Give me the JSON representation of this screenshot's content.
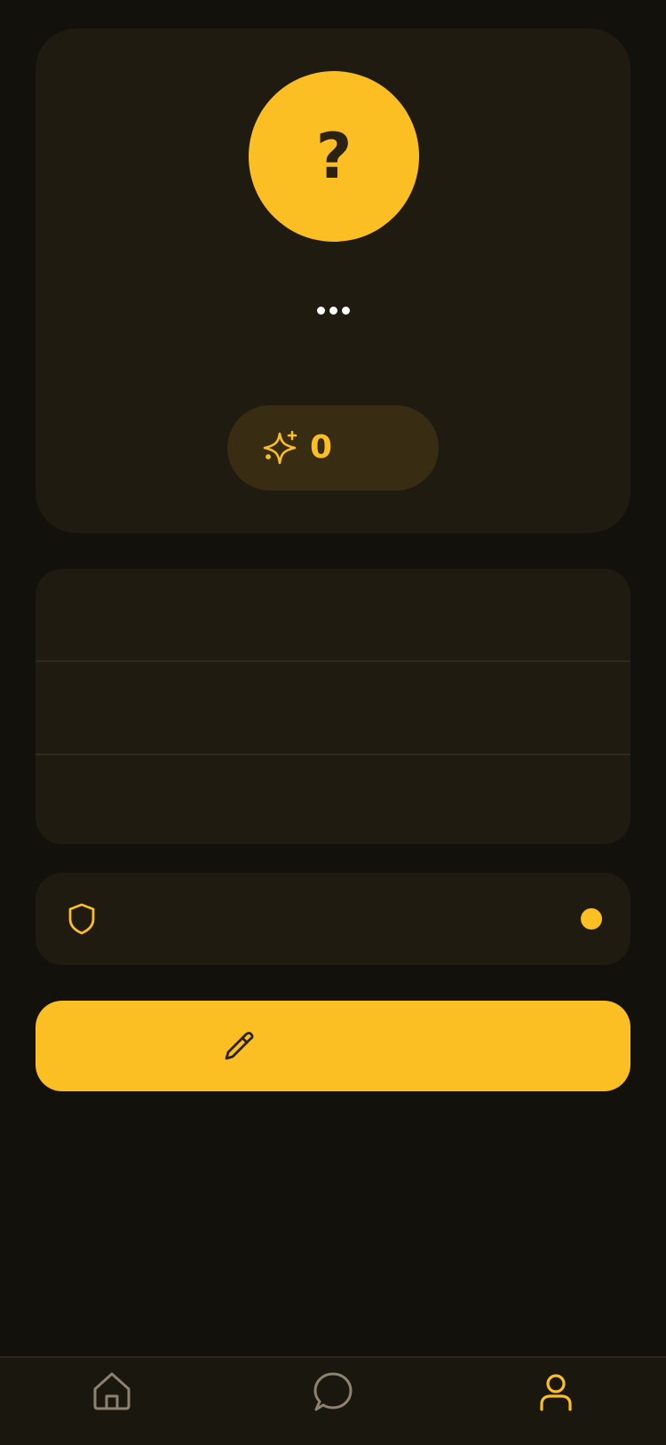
{
  "profile": {
    "avatar_placeholder": "?",
    "points": "0"
  },
  "colors": {
    "background": "#13110b",
    "card": "#1f1b10",
    "accent": "#fbbf24",
    "nav_inactive": "#8c8270"
  },
  "icons": {
    "points": "sparkles-icon",
    "privacy": "shield-icon",
    "edit": "pencil-icon",
    "nav_home": "home-icon",
    "nav_chat": "chat-bubble-icon",
    "nav_profile": "user-icon"
  },
  "bottom_nav": {
    "active": "profile"
  }
}
